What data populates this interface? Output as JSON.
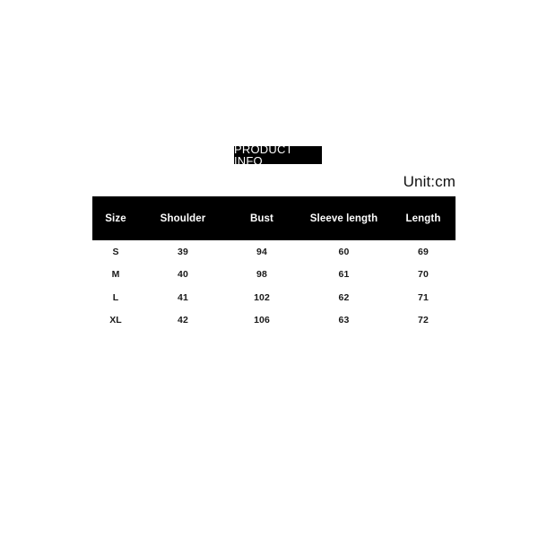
{
  "page": {
    "background_color": "#ffffff",
    "badge_color": "#000000",
    "badge_text_color": "#ffffff",
    "body_text_color": "#1a1a1a"
  },
  "header": {
    "product_info_label": "PRODUCT INFO",
    "unit_label": "Unit:cm"
  },
  "size_table": {
    "columns": [
      "Size",
      "Shoulder",
      "Bust",
      "Sleeve length",
      "Length"
    ],
    "rows": [
      {
        "size": "S",
        "shoulder": "39",
        "bust": "94",
        "sleeve_length": "60",
        "length": "69"
      },
      {
        "size": "M",
        "shoulder": "40",
        "bust": "98",
        "sleeve_length": "61",
        "length": "70"
      },
      {
        "size": "L",
        "shoulder": "41",
        "bust": "102",
        "sleeve_length": "62",
        "length": "71"
      },
      {
        "size": "XL",
        "shoulder": "42",
        "bust": "106",
        "sleeve_length": "63",
        "length": "72"
      }
    ]
  }
}
